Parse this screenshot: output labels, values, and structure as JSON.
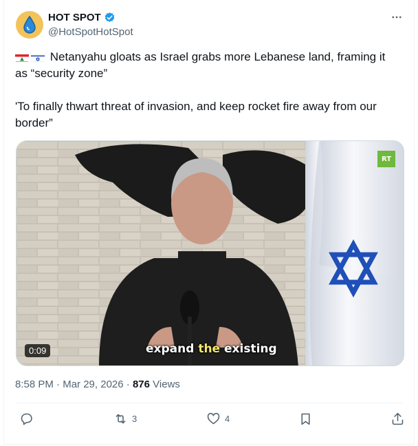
{
  "author": {
    "display_name": "HOT SPOT",
    "handle": "@HotSpotHotSpot",
    "verified_icon": "verified-badge-icon",
    "avatar_icon": "droplet-icon"
  },
  "post": {
    "line1": "Netanyahu gloats as Israel grabs more Lebanese land, framing it as “security zone”",
    "line2": "'To finally thwart threat of invasion, and keep rocket fire away from our border”",
    "flags": [
      "lebanon-flag-icon",
      "israel-flag-icon"
    ]
  },
  "video": {
    "duration": "0:09",
    "caption_pre": "expand ",
    "caption_highlight": "the",
    "caption_post": " existing",
    "watermark": "RT"
  },
  "meta": {
    "time": "8:58 PM",
    "separator": "·",
    "date": "Mar 29, 2026",
    "views_count": "876",
    "views_label": "Views"
  },
  "actions": {
    "reposts": "3",
    "likes": "4"
  },
  "colors": {
    "accent": "#1d9bf0",
    "text": "#0f1419",
    "muted": "#536471",
    "rt_green": "#6fb93c"
  }
}
